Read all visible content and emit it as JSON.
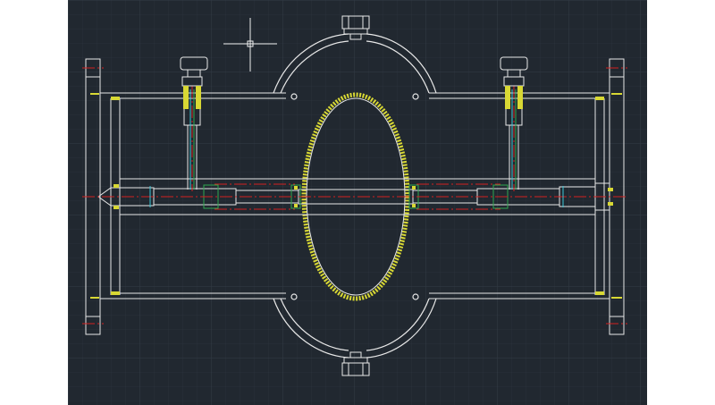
{
  "viewport": {
    "background": "#212830",
    "grid_minor_color": "#2a323b",
    "grid_major_color": "#2f3842"
  },
  "colors": {
    "outline": "#e8e8e8",
    "centerline": "#d42020",
    "hatch": "#d8d834",
    "fitting_green": "#2fa84f",
    "accent_cyan": "#39c6d6"
  },
  "drawing": {
    "crosshair": "crosshair-cursor-icon",
    "clamp_top": "hex-bolt-icon",
    "clamp_bottom": "hex-bolt-icon",
    "valve_handles": [
      "t-handle-icon",
      "t-handle-icon"
    ]
  }
}
